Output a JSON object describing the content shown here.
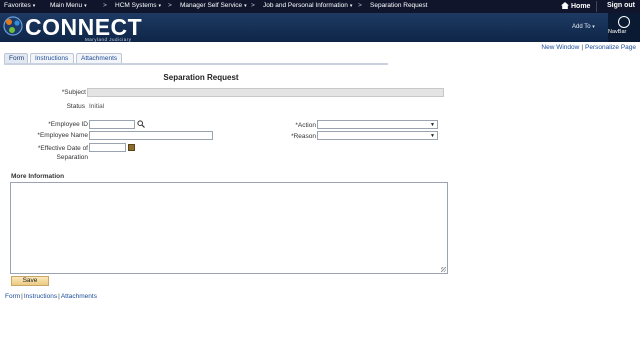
{
  "topnav": {
    "items": [
      {
        "label": "Favorites",
        "arrow": "▾"
      },
      {
        "label": "Main Menu",
        "arrow": "▾"
      },
      {
        "label": "HCM Systems",
        "arrow": "▾"
      },
      {
        "label": "Manager Self Service",
        "arrow": "▾"
      },
      {
        "label": "Job and Personal Information",
        "arrow": "▾"
      },
      {
        "label": "Separation Request",
        "arrow": ""
      }
    ],
    "separator": ">",
    "home": "Home",
    "sign_out": "Sign out"
  },
  "banner": {
    "logo_text": "CONNECT",
    "logo_sub": "Maryland Judiciary",
    "add_to": "Add To",
    "add_to_arrow": "▾",
    "navbar": "NavBar"
  },
  "links": {
    "new_window": "New Window",
    "personalize": "Personalize Page",
    "bar": "|"
  },
  "tabs": [
    {
      "label": "Form",
      "active": true
    },
    {
      "label": "Instructions",
      "active": false
    },
    {
      "label": "Attachments",
      "active": false
    }
  ],
  "form": {
    "title": "Separation Request",
    "subject_label": "*Subject",
    "subject_value": "",
    "status_label": "Status",
    "status_value": "Initial",
    "employee_id_label": "*Employee ID",
    "employee_id_value": "",
    "employee_name_label": "*Employee Name",
    "employee_name_value": "",
    "effective_date_label_1": "*Effective Date of",
    "effective_date_label_2": "Separation",
    "effective_date_value": "",
    "action_label": "*Action",
    "action_value": "",
    "reason_label": "*Reason",
    "reason_value": "",
    "more_info_label": "More Information",
    "more_info_value": "",
    "save_label": "Save"
  },
  "bottom_links": [
    "Form",
    "Instructions",
    "Attachments"
  ]
}
